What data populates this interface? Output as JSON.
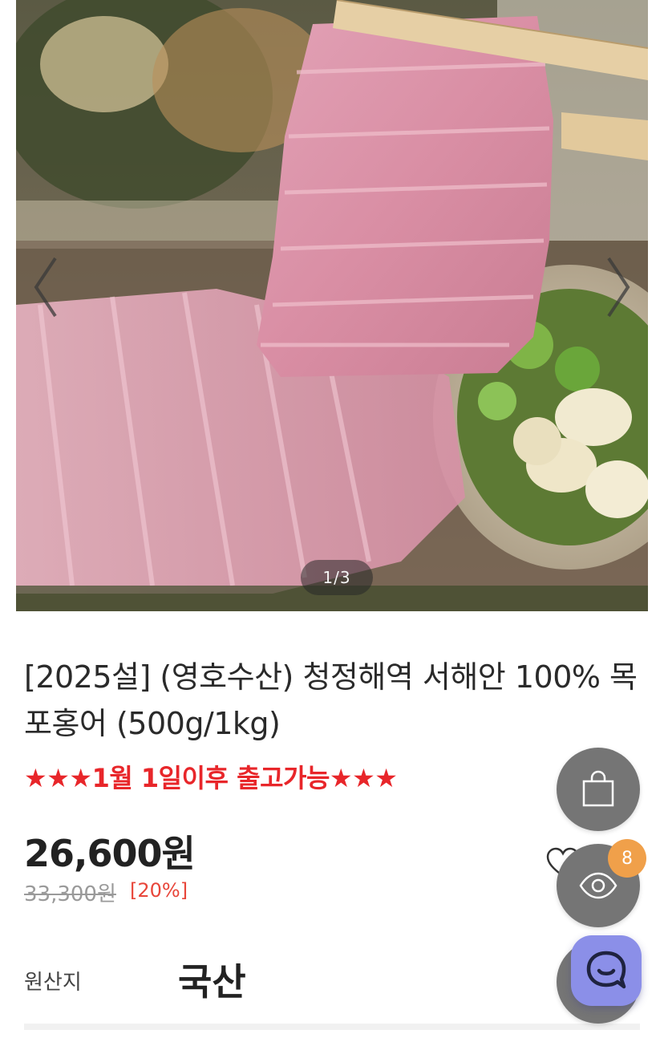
{
  "carousel": {
    "counter": "1/3",
    "current": 1,
    "total": 3
  },
  "product": {
    "title": "[2025설] (영호수산) 청정해역 서해안 100% 목포홍어 (500g/1kg)",
    "notice": "★★★1월 1일이후 출고가능★★★",
    "price": "26,600원",
    "original_price": "33,300원",
    "discount": "[20%]",
    "origin_label": "원산지",
    "origin_value": "국산"
  },
  "floating": {
    "viewed_count": "8"
  },
  "icons": {
    "prev": "chevron-left-icon",
    "next": "chevron-right-icon",
    "cart": "shopping-bag-icon",
    "viewed": "eye-icon",
    "wishlist": "heart-icon",
    "chat": "chat-icon"
  },
  "colors": {
    "notice": "#e8262a",
    "discount": "#e8463a",
    "fab": "#757575",
    "badge": "#f0a04a",
    "chat": "#8b8fe8"
  }
}
